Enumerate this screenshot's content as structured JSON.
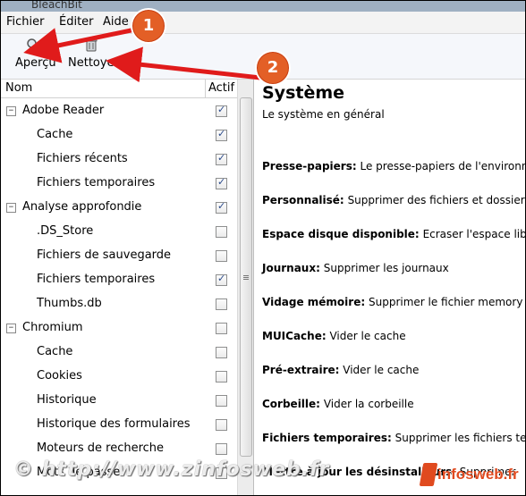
{
  "window": {
    "title": "BleachBit"
  },
  "menu": {
    "items": [
      "Fichier",
      "Éditer",
      "Aide"
    ]
  },
  "toolbar": {
    "preview_label": "Aperçu",
    "clean_label": "Nettoyer"
  },
  "tree": {
    "headers": {
      "name": "Nom",
      "active": "Actif"
    },
    "rows": [
      {
        "label": "Adobe Reader",
        "level": 0,
        "checked": true
      },
      {
        "label": "Cache",
        "level": 1,
        "checked": true
      },
      {
        "label": "Fichiers récents",
        "level": 1,
        "checked": true
      },
      {
        "label": "Fichiers temporaires",
        "level": 1,
        "checked": true
      },
      {
        "label": "Analyse approfondie",
        "level": 0,
        "checked": true
      },
      {
        "label": ".DS_Store",
        "level": 1,
        "checked": false
      },
      {
        "label": "Fichiers de sauvegarde",
        "level": 1,
        "checked": false
      },
      {
        "label": "Fichiers temporaires",
        "level": 1,
        "checked": true
      },
      {
        "label": "Thumbs.db",
        "level": 1,
        "checked": false
      },
      {
        "label": "Chromium",
        "level": 0,
        "checked": false
      },
      {
        "label": "Cache",
        "level": 1,
        "checked": false
      },
      {
        "label": "Cookies",
        "level": 1,
        "checked": false
      },
      {
        "label": "Historique",
        "level": 1,
        "checked": false
      },
      {
        "label": "Historique des formulaires",
        "level": 1,
        "checked": false
      },
      {
        "label": "Moteurs de recherche",
        "level": 1,
        "checked": false
      },
      {
        "label": "Mots de passe",
        "level": 1,
        "checked": false
      }
    ]
  },
  "detail": {
    "title": "Système",
    "subtitle": "Le système en général",
    "entries": [
      {
        "name": "Presse-papiers:",
        "desc": "Le presse-papiers de l'environnement"
      },
      {
        "name": "Personnalisé:",
        "desc": "Supprimer des fichiers et dossiers"
      },
      {
        "name": "Espace disque disponible:",
        "desc": "Ecraser l'espace libre"
      },
      {
        "name": "Journaux:",
        "desc": "Supprimer les journaux"
      },
      {
        "name": "Vidage mémoire:",
        "desc": "Supprimer le fichier memory"
      },
      {
        "name": "MUICache:",
        "desc": "Vider le cache"
      },
      {
        "name": "Pré-extraire:",
        "desc": "Vider le cache"
      },
      {
        "name": "Corbeille:",
        "desc": "Vider la corbeille"
      },
      {
        "name": "Fichiers temporaires:",
        "desc": "Supprimer les fichiers temporaires"
      },
      {
        "name": "Mettre à jour les désinstalleurs:",
        "desc": "Supprimer"
      }
    ]
  },
  "annotations": {
    "badge_1": "1",
    "badge_2": "2",
    "arrow_color": "#e01b1b"
  },
  "watermark": {
    "text": "© http://www.zinfosweb.fr",
    "logo": "infosweb.fr"
  },
  "colors": {
    "badge": "#e35f26",
    "checkmark": "#2a4a8a"
  }
}
